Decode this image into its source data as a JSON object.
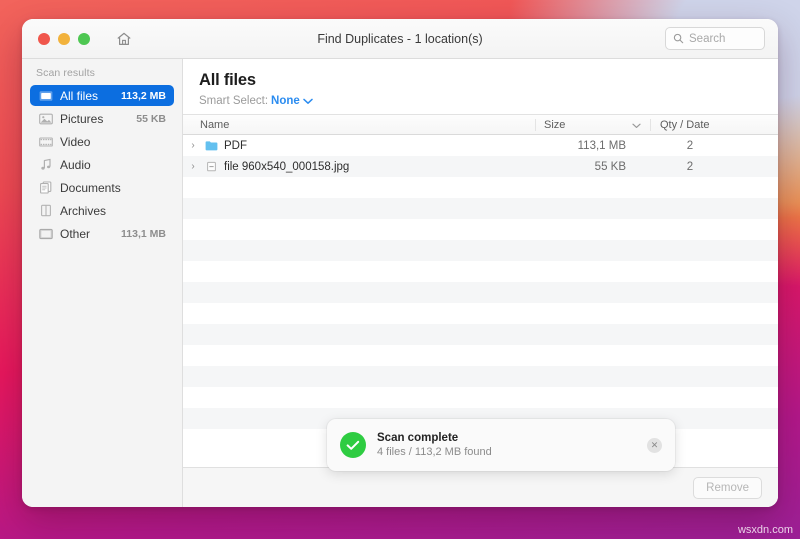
{
  "window": {
    "title": "Find Duplicates - 1 location(s)",
    "traffic_lights": [
      "close-red",
      "minimize-yellow",
      "maximize-green"
    ],
    "home_icon": "home-icon",
    "search": {
      "placeholder": "Search",
      "value": "",
      "icon": "search-icon"
    }
  },
  "sidebar": {
    "heading": "Scan results",
    "items": [
      {
        "label": "All files",
        "size": "113,2 MB",
        "icon": "all-files-icon",
        "selected": true
      },
      {
        "label": "Pictures",
        "size": "55 KB",
        "icon": "picture-icon",
        "selected": false
      },
      {
        "label": "Video",
        "size": "",
        "icon": "film-icon",
        "selected": false
      },
      {
        "label": "Audio",
        "size": "",
        "icon": "music-note-icon",
        "selected": false
      },
      {
        "label": "Documents",
        "size": "",
        "icon": "documents-icon",
        "selected": false
      },
      {
        "label": "Archives",
        "size": "",
        "icon": "archive-icon",
        "selected": false
      },
      {
        "label": "Other",
        "size": "113,1 MB",
        "icon": "other-icon",
        "selected": false
      }
    ]
  },
  "main": {
    "page_title": "All files",
    "smart_select_label": "Smart Select:",
    "smart_select_value": "None",
    "smart_select_icon": "chevron-down-icon",
    "columns": [
      {
        "key": "name",
        "label": "Name"
      },
      {
        "key": "size",
        "label": "Size",
        "sort_icon": "chevron-down-icon"
      },
      {
        "key": "qty",
        "label": "Qty / Date"
      }
    ],
    "rows": [
      {
        "twisty": "›",
        "icon": "folder-icon",
        "name": "PDF",
        "size": "113,1 MB",
        "qty": "2"
      },
      {
        "twisty": "›",
        "icon": "file-icon",
        "name": "file 960x540_000158.jpg",
        "size": "55 KB",
        "qty": "2"
      }
    ],
    "empty_row_count": 13
  },
  "toast": {
    "status_icon": "check-circle-icon",
    "title": "Scan complete",
    "subtitle": "4 files / 113,2 MB found",
    "close_icon": "close-icon",
    "close_glyph": "✕"
  },
  "footer": {
    "remove_label": "Remove",
    "remove_enabled": false
  },
  "watermark": "wsxdn.com",
  "colors": {
    "accent_blue": "#0c6ee0",
    "link_blue": "#2b8cf0",
    "success_green": "#2ecc41",
    "sidebar_bg": "#f4f4f4",
    "row_stripe": "#f5f6f7"
  }
}
